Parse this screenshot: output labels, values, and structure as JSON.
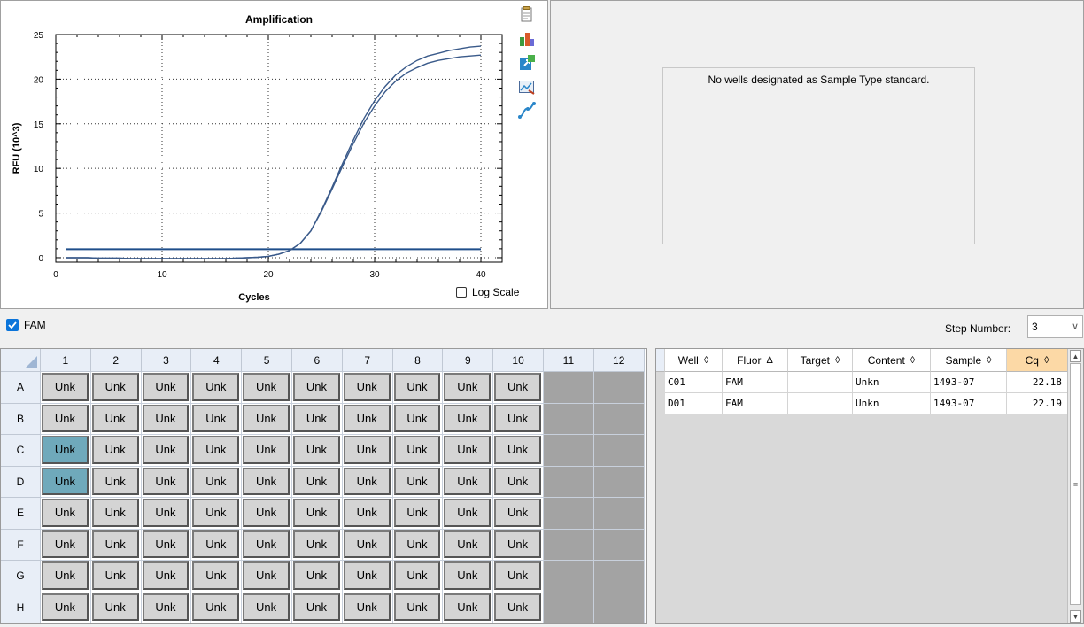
{
  "chart": {
    "title": "Amplification",
    "ylabel": "RFU (10^3)",
    "xlabel": "Cycles",
    "log_scale_label": "Log Scale",
    "log_scale_checked": false,
    "tools": [
      "copy-icon",
      "color-icon",
      "export-icon",
      "chart-options-icon",
      "curve-icon"
    ]
  },
  "chart_data": {
    "type": "line",
    "title": "Amplification",
    "xlabel": "Cycles",
    "ylabel": "RFU (10^3)",
    "xlim": [
      0,
      42
    ],
    "ylim": [
      -0.5,
      25
    ],
    "x_ticks": [
      0,
      10,
      20,
      30,
      40
    ],
    "y_ticks": [
      0,
      5,
      10,
      15,
      20,
      25
    ],
    "grid": true,
    "series_color": "#3a5a8a",
    "threshold": 0.95,
    "series": [
      {
        "x": [
          1,
          2,
          3,
          4,
          5,
          6,
          7,
          8,
          9,
          10,
          11,
          12,
          13,
          14,
          15,
          16,
          17,
          18,
          19,
          20,
          21,
          22,
          23,
          24,
          25,
          26,
          27,
          28,
          29,
          30,
          31,
          32,
          33,
          34,
          35,
          36,
          37,
          38,
          39,
          40
        ],
        "values": [
          0.0,
          0.0,
          0.0,
          -0.05,
          -0.05,
          -0.05,
          -0.1,
          -0.1,
          -0.1,
          -0.1,
          -0.1,
          -0.1,
          -0.1,
          -0.1,
          -0.1,
          -0.1,
          -0.05,
          0.0,
          0.05,
          0.15,
          0.4,
          0.8,
          1.6,
          3.0,
          5.3,
          7.9,
          10.6,
          13.2,
          15.6,
          17.6,
          19.2,
          20.5,
          21.4,
          22.1,
          22.6,
          22.9,
          23.2,
          23.4,
          23.6,
          23.7
        ]
      },
      {
        "x": [
          1,
          2,
          3,
          4,
          5,
          6,
          7,
          8,
          9,
          10,
          11,
          12,
          13,
          14,
          15,
          16,
          17,
          18,
          19,
          20,
          21,
          22,
          23,
          24,
          25,
          26,
          27,
          28,
          29,
          30,
          31,
          32,
          33,
          34,
          35,
          36,
          37,
          38,
          39,
          40
        ],
        "values": [
          0.0,
          0.0,
          0.0,
          -0.05,
          -0.05,
          -0.05,
          -0.1,
          -0.1,
          -0.1,
          -0.1,
          -0.1,
          -0.1,
          -0.1,
          -0.1,
          -0.1,
          -0.1,
          -0.05,
          0.0,
          0.05,
          0.15,
          0.4,
          0.8,
          1.6,
          3.0,
          5.2,
          7.7,
          10.3,
          12.8,
          15.1,
          17.0,
          18.6,
          19.8,
          20.7,
          21.3,
          21.8,
          22.1,
          22.3,
          22.5,
          22.6,
          22.7
        ]
      }
    ]
  },
  "standard_curve": {
    "message": "No wells designated as Sample Type standard."
  },
  "fluor_bar": {
    "fam_label": "FAM",
    "fam_checked": true,
    "step_label": "Step Number:",
    "step_value": "3"
  },
  "plate": {
    "columns": [
      "1",
      "2",
      "3",
      "4",
      "5",
      "6",
      "7",
      "8",
      "9",
      "10",
      "11",
      "12"
    ],
    "rows": [
      "A",
      "B",
      "C",
      "D",
      "E",
      "F",
      "G",
      "H"
    ],
    "filled_columns": 10,
    "well_label": "Unk",
    "selected_wells": [
      "C1",
      "D1"
    ]
  },
  "results": {
    "columns": [
      {
        "label": "Well",
        "sort": "◊"
      },
      {
        "label": "Fluor",
        "sort": "Δ"
      },
      {
        "label": "Target",
        "sort": "◊"
      },
      {
        "label": "Content",
        "sort": "◊"
      },
      {
        "label": "Sample",
        "sort": "◊"
      },
      {
        "label": "Cq",
        "sort": "◊"
      }
    ],
    "rows": [
      {
        "well": "C01",
        "fluor": "FAM",
        "target": "",
        "content": "Unkn",
        "sample": "1493-07",
        "cq": "22.18"
      },
      {
        "well": "D01",
        "fluor": "FAM",
        "target": "",
        "content": "Unkn",
        "sample": "1493-07",
        "cq": "22.19"
      }
    ]
  }
}
